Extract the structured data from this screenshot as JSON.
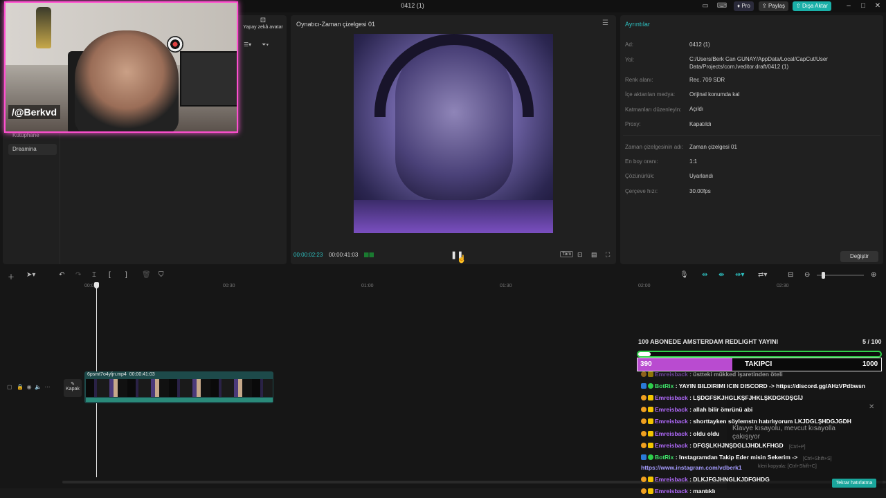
{
  "window": {
    "title": "0412 (1)",
    "pro_label": "Pro",
    "share_label": "Paylaş",
    "export_label": "Dışa Aktar",
    "minimize": "–",
    "maximize": "□",
    "close": "✕"
  },
  "media_panel": {
    "avatar_button": "Yapay zekâ avatar",
    "nav_library": "Kütüphane",
    "nav_dreamina": "Dreamina"
  },
  "webcam": {
    "handle": "/@Berkvd"
  },
  "player": {
    "title": "Oynatıcı-Zaman çizelgesi 01",
    "time_current": "00:00:02:23",
    "time_total": "00:00:41:03",
    "ratio_label": "Tam"
  },
  "details": {
    "title": "Ayrıntılar",
    "rows": [
      {
        "label": "Ad:",
        "value": "0412 (1)"
      },
      {
        "label": "Yol:",
        "value": "C:/Users/Berk Can GUNAY/AppData/Local/CapCut/User Data/Projects/com.lveditor.draft/0412 (1)"
      },
      {
        "label": "Renk alanı:",
        "value": "Rec. 709 SDR"
      },
      {
        "label": "İçe aktarılan medya:",
        "value": "Orijinal konumda kal"
      },
      {
        "label": "Katmanları düzenleyin:",
        "value": "Açıldı"
      },
      {
        "label": "Proxy:",
        "value": "Kapatıldı"
      },
      {
        "label": "Zaman çizelgesinin adı:",
        "value": "Zaman çizelgesi 01"
      },
      {
        "label": "En boy oranı:",
        "value": "1:1"
      },
      {
        "label": "Çözünürlük:",
        "value": "Uyarlandı"
      },
      {
        "label": "Çerçeve hızı:",
        "value": "30.00fps"
      }
    ],
    "change_button": "Değiştir"
  },
  "timeline": {
    "ticks": [
      "00:00",
      "00:30",
      "01:00",
      "01:30",
      "02:00",
      "02:30"
    ],
    "cover_label": "Kapak",
    "clip_name": "6psmt7o4yljn.mp4",
    "clip_duration": "00:00:41:03"
  },
  "overlay": {
    "goal_title": "100 ABONEDE AMSTERDAM REDLIGHT YAYINI",
    "goal_count": "5 / 100",
    "goal_progress": 0.05,
    "follower_current": "390",
    "follower_label": "TAKIPCI",
    "follower_goal": "1000",
    "follower_progress": 0.39
  },
  "chat": [
    {
      "user": "Emreisback",
      "badge": "sub",
      "text": "üstteki mükked işaretinden öteli"
    },
    {
      "user": "BotRix",
      "badge": "bot",
      "text": "YAYIN BILDIRIMI ICIN DISCORD -> https://discord.gg/AHzVPdbwsn"
    },
    {
      "user": "Emreisback",
      "badge": "sub",
      "text": "LŞDGFSKJHGLKŞFJHKLŞKDGKDŞGİJ"
    },
    {
      "user": "Emreisback",
      "badge": "sub",
      "text": "allah bilir ömrünü abi"
    },
    {
      "user": "Emreisback",
      "badge": "sub",
      "text": "shorttayken söylemstn hatırlıyorum LKJDGLŞHDGJGDH"
    },
    {
      "user": "Emreisback",
      "badge": "sub",
      "text": "oldu oldu"
    },
    {
      "user": "Emreisback",
      "badge": "sub",
      "text": "DFGŞLKHJNŞDGLIJHDLKFHGD"
    },
    {
      "user": "BotRix",
      "badge": "bot",
      "text": "Instagramdan Takip Eder misin Sekerim ->"
    },
    {
      "user": "",
      "badge": "none",
      "text": "https://www.instagram.com/vdberk1"
    },
    {
      "user": "Emreisback",
      "badge": "sub",
      "text": "DLKJFGJHNGLKJDFGHDG"
    },
    {
      "user": "Emreisback",
      "badge": "sub",
      "text": "mantıklı"
    }
  ],
  "tooltip": {
    "message": "Klavye kısayolu, mevcut kısayolla çakışıyor",
    "shortcuts": [
      "[Ctrl+P]",
      "[Ctrl+Shift+S]",
      "kleri kopyala: [Ctrl+Shift+C]"
    ],
    "restore_button": "Tekrar hatırlatma"
  },
  "colors": {
    "accent": "#2ec1c1",
    "export": "#1ab0a8",
    "webcam_border": "#ff4fd0",
    "goal_border": "#31d04a",
    "follower_fill": "#b94bd0",
    "chat_user_sub": "#b36bff",
    "chat_user_bot": "#3fe36a"
  }
}
